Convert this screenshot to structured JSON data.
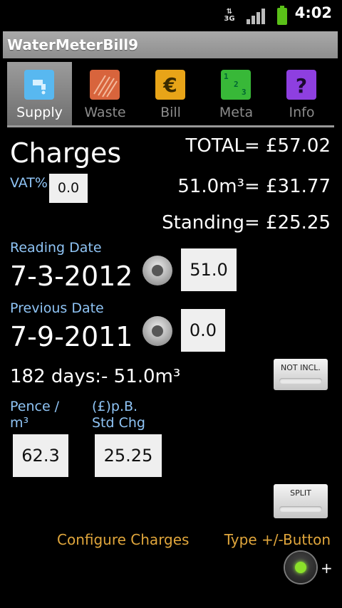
{
  "status_bar": {
    "network": "3G",
    "time": "4:02"
  },
  "app": {
    "title": "WaterMeterBill9"
  },
  "tabs": [
    {
      "label": "Supply",
      "icon": "tap-icon",
      "color": "#58b8f0",
      "active": true
    },
    {
      "label": "Waste",
      "icon": "drain-grate-icon",
      "color": "#d8643c",
      "active": false
    },
    {
      "label": "Bill",
      "icon": "euro-icon",
      "color": "#e8a418",
      "active": false
    },
    {
      "label": "Meta",
      "icon": "numbers-grid-icon",
      "color": "#38b838",
      "active": false
    },
    {
      "label": "Info",
      "icon": "question-icon",
      "color": "#8e3fe0",
      "active": false
    }
  ],
  "charges": {
    "heading": "Charges",
    "vat_label": "VAT%",
    "vat_value": "0.0",
    "total": "TOTAL= £57.02",
    "usage_cost": "51.0m³= £31.77",
    "standing": "Standing= £25.25"
  },
  "readings": {
    "reading_date_label": "Reading Date",
    "reading_date": "7-3-2012",
    "reading_value": "51.0",
    "previous_date_label": "Previous Date",
    "previous_date": "7-9-2011",
    "previous_value": "0.0",
    "summary": "182 days:- 51.0m³",
    "not_incl_label": "NOT INCL."
  },
  "rates": {
    "pence_label_1": "Pence /",
    "pence_label_2": "m³",
    "pence_value": "62.3",
    "std_label_1": "(£)p.B.",
    "std_label_2": "Std Chg",
    "std_value": "25.25",
    "split_label": "SPLIT"
  },
  "footer": {
    "configure": "Configure Charges",
    "type_button": "Type +/-Button",
    "plus": "+"
  }
}
